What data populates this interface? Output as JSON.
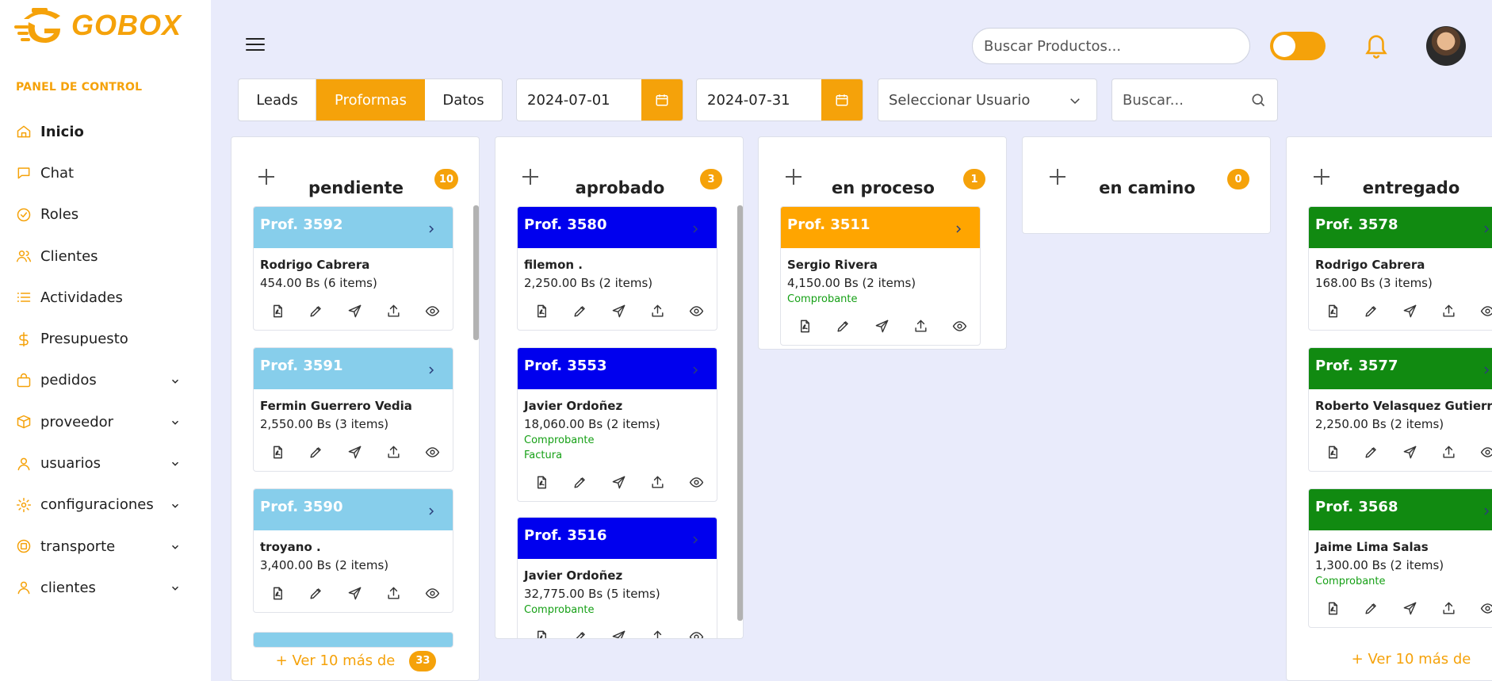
{
  "brand": {
    "name": "GOBOX",
    "accent": "#f5a20a"
  },
  "sidebar": {
    "section_label": "PANEL DE CONTROL",
    "items": [
      {
        "label": "Inicio",
        "icon": "home-icon"
      },
      {
        "label": "Chat",
        "icon": "chat-icon"
      },
      {
        "label": "Roles",
        "icon": "check-badge-icon"
      },
      {
        "label": "Clientes",
        "icon": "users-icon"
      },
      {
        "label": "Actividades",
        "icon": "list-icon"
      },
      {
        "label": "Presupuesto",
        "icon": "dollar-icon"
      },
      {
        "label": "pedidos",
        "icon": "bag-icon"
      },
      {
        "label": "proveedor",
        "icon": "box-icon"
      },
      {
        "label": "usuarios",
        "icon": "user-icon"
      },
      {
        "label": "configuraciones",
        "icon": "gear-icon"
      },
      {
        "label": "transporte",
        "icon": "truck-icon"
      },
      {
        "label": "clientes",
        "icon": "user-icon"
      }
    ]
  },
  "topbar": {
    "search_placeholder": "Buscar Productos..."
  },
  "filters": {
    "tabs": [
      "Leads",
      "Proformas",
      "Datos"
    ],
    "active_tab": "Proformas",
    "date_from": "2024-07-01",
    "date_to": "2024-07-31",
    "user_select": "Seleccionar Usuario",
    "search_placeholder": "Buscar..."
  },
  "colors": {
    "pendiente": "#87ceeb",
    "aprobado": "#0000ee",
    "en_proceso": "#ffa500",
    "entregado": "#118a11",
    "tag_green": "#16a016"
  },
  "columns": [
    {
      "title": "pendiente",
      "count": "10",
      "color": "#87ceeb",
      "more_label": "+ Ver 10 más de",
      "more_count": "33",
      "cards": [
        {
          "id": "Prof. 3592",
          "client": "Rodrigo Cabrera",
          "amount": "454.00 Bs (6 items)",
          "tags": []
        },
        {
          "id": "Prof. 3591",
          "client": "Fermin Guerrero Vedia",
          "amount": "2,550.00 Bs (3 items)",
          "tags": []
        },
        {
          "id": "Prof. 3590",
          "client": "troyano .",
          "amount": "3,400.00 Bs (2 items)",
          "tags": []
        }
      ]
    },
    {
      "title": "aprobado",
      "count": "3",
      "color": "#0000ee",
      "cards": [
        {
          "id": "Prof. 3580",
          "client": "filemon .",
          "amount": "2,250.00 Bs (2 items)",
          "tags": []
        },
        {
          "id": "Prof. 3553",
          "client": "Javier Ordoñez",
          "amount": "18,060.00 Bs (2 items)",
          "tags": [
            "Comprobante",
            "Factura"
          ]
        },
        {
          "id": "Prof. 3516",
          "client": "Javier Ordoñez",
          "amount": "32,775.00 Bs (5 items)",
          "tags": [
            "Comprobante"
          ]
        }
      ]
    },
    {
      "title": "en proceso",
      "count": "1",
      "color": "#ffa500",
      "cards": [
        {
          "id": "Prof. 3511",
          "client": "Sergio Rivera",
          "amount": "4,150.00 Bs (2 items)",
          "tags": [
            "Comprobante"
          ]
        }
      ]
    },
    {
      "title": "en camino",
      "count": "0",
      "color": "#ffa500",
      "cards": []
    },
    {
      "title": "entregado",
      "count": "",
      "color": "#118a11",
      "more_label": "+ Ver 10 más de",
      "cards": [
        {
          "id": "Prof. 3578",
          "client": "Rodrigo Cabrera",
          "amount": "168.00 Bs (3 items)",
          "tags": []
        },
        {
          "id": "Prof. 3577",
          "client": "Roberto Velasquez Gutierrez",
          "amount": "2,250.00 Bs (2 items)",
          "tags": []
        },
        {
          "id": "Prof. 3568",
          "client": "Jaime Lima Salas",
          "amount": "1,300.00 Bs (2 items)",
          "tags": [
            "Comprobante"
          ]
        }
      ]
    }
  ],
  "card_actions": [
    "pdf-icon",
    "edit-icon",
    "send-icon",
    "upload-icon",
    "view-icon"
  ]
}
